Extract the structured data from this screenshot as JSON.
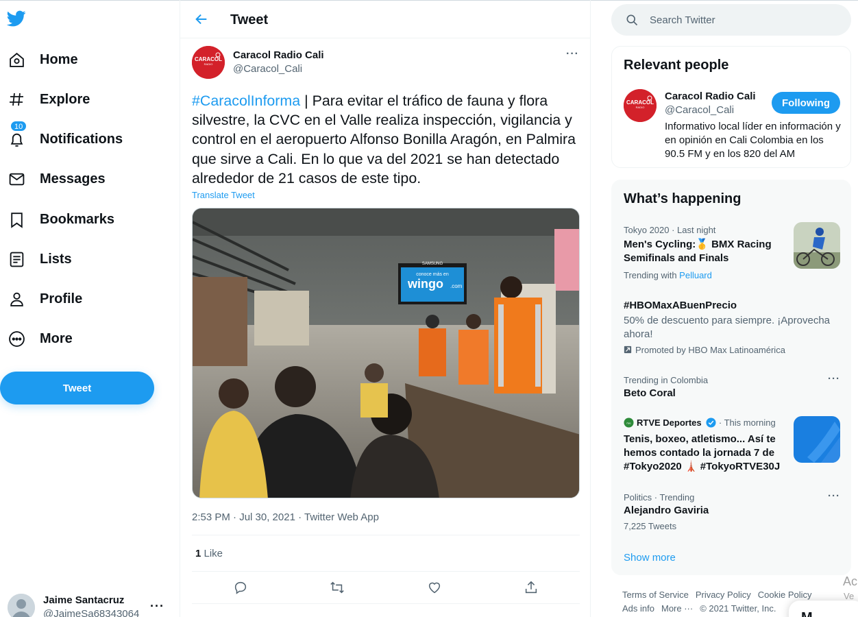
{
  "nav": {
    "items": [
      {
        "label": "Home",
        "icon": "home-icon"
      },
      {
        "label": "Explore",
        "icon": "hashtag-icon"
      },
      {
        "label": "Notifications",
        "icon": "bell-icon",
        "badge": "10"
      },
      {
        "label": "Messages",
        "icon": "envelope-icon"
      },
      {
        "label": "Bookmarks",
        "icon": "bookmark-icon"
      },
      {
        "label": "Lists",
        "icon": "list-icon"
      },
      {
        "label": "Profile",
        "icon": "person-icon"
      },
      {
        "label": "More",
        "icon": "more-circle-icon"
      }
    ],
    "tweet_button": "Tweet"
  },
  "account": {
    "name": "Jaime Santacruz",
    "handle": "@JaimeSa68343064",
    "more": "···"
  },
  "header": {
    "title": "Tweet"
  },
  "tweet": {
    "author_name": "Caracol Radio Cali",
    "author_handle": "@Caracol_Cali",
    "more": "···",
    "hashtag": "#CaracolInforma",
    "text": " | Para evitar el tráfico de fauna y flora silvestre, la CVC en el Valle realiza inspección, vigilancia y control en el aeropuerto Alfonso Bonilla Aragón, en Palmira que sirve a Cali. En lo que va del 2021 se han detectado alrededor de 21 casos de este tipo.",
    "translate": "Translate Tweet",
    "media_sign_top": "SAMSUNG",
    "media_sign_main": "wingo",
    "media_sign_tld": ".com",
    "media_sign_caption": "conoce más en",
    "timestamp": "2:53 PM · Jul 30, 2021 · Twitter Web App",
    "likes_count": "1",
    "likes_label": " Like"
  },
  "search": {
    "placeholder": "Search Twitter"
  },
  "relevant": {
    "title": "Relevant people",
    "name": "Caracol Radio Cali",
    "handle": "@Caracol_Cali",
    "follow": "Following",
    "bio": "Informativo local líder en información y en opinión en Cali Colombia en los 90.5 FM y en los 820 del AM"
  },
  "happening": {
    "title": "What’s happening",
    "trends": [
      {
        "context": "Tokyo 2020 · Last night",
        "title": "Men's Cycling:🥇 BMX Racing Semifinals and Finals",
        "sub_prefix": "Trending with ",
        "sub_link": "Pelluard"
      },
      {
        "title": "#HBOMaxABuenPrecio",
        "sub": "50% de descuento para siempre. ¡Aprovecha ahora!",
        "promo": "Promoted by HBO Max Latinoamérica"
      },
      {
        "context": "Trending in Colombia",
        "title": "Beto Coral",
        "more": "···"
      },
      {
        "source": "RTVE Deportes",
        "time": " · This morning",
        "title": "Tenis, boxeo, atletismo... Así te hemos contado la jornada 7 de #Tokyo2020 🗼 #TokyoRTVE30J"
      },
      {
        "context": "Politics · Trending",
        "title": "Alejandro Gaviria",
        "count": "7,225 Tweets",
        "more": "···"
      }
    ],
    "show_more": "Show more"
  },
  "footer": {
    "links": [
      "Terms of Service",
      "Privacy Policy",
      "Cookie Policy",
      "Ads info",
      "More ···",
      "© 2021 Twitter, Inc."
    ]
  },
  "messages_drawer": {
    "label": "M"
  },
  "watermark": {
    "line1": "Ac",
    "line2": "Ve"
  },
  "colors": {
    "accent": "#1d9bf0",
    "text": "#0f1419",
    "muted": "#536471",
    "border": "#eff3f4",
    "caracol_red": "#d3212a"
  }
}
